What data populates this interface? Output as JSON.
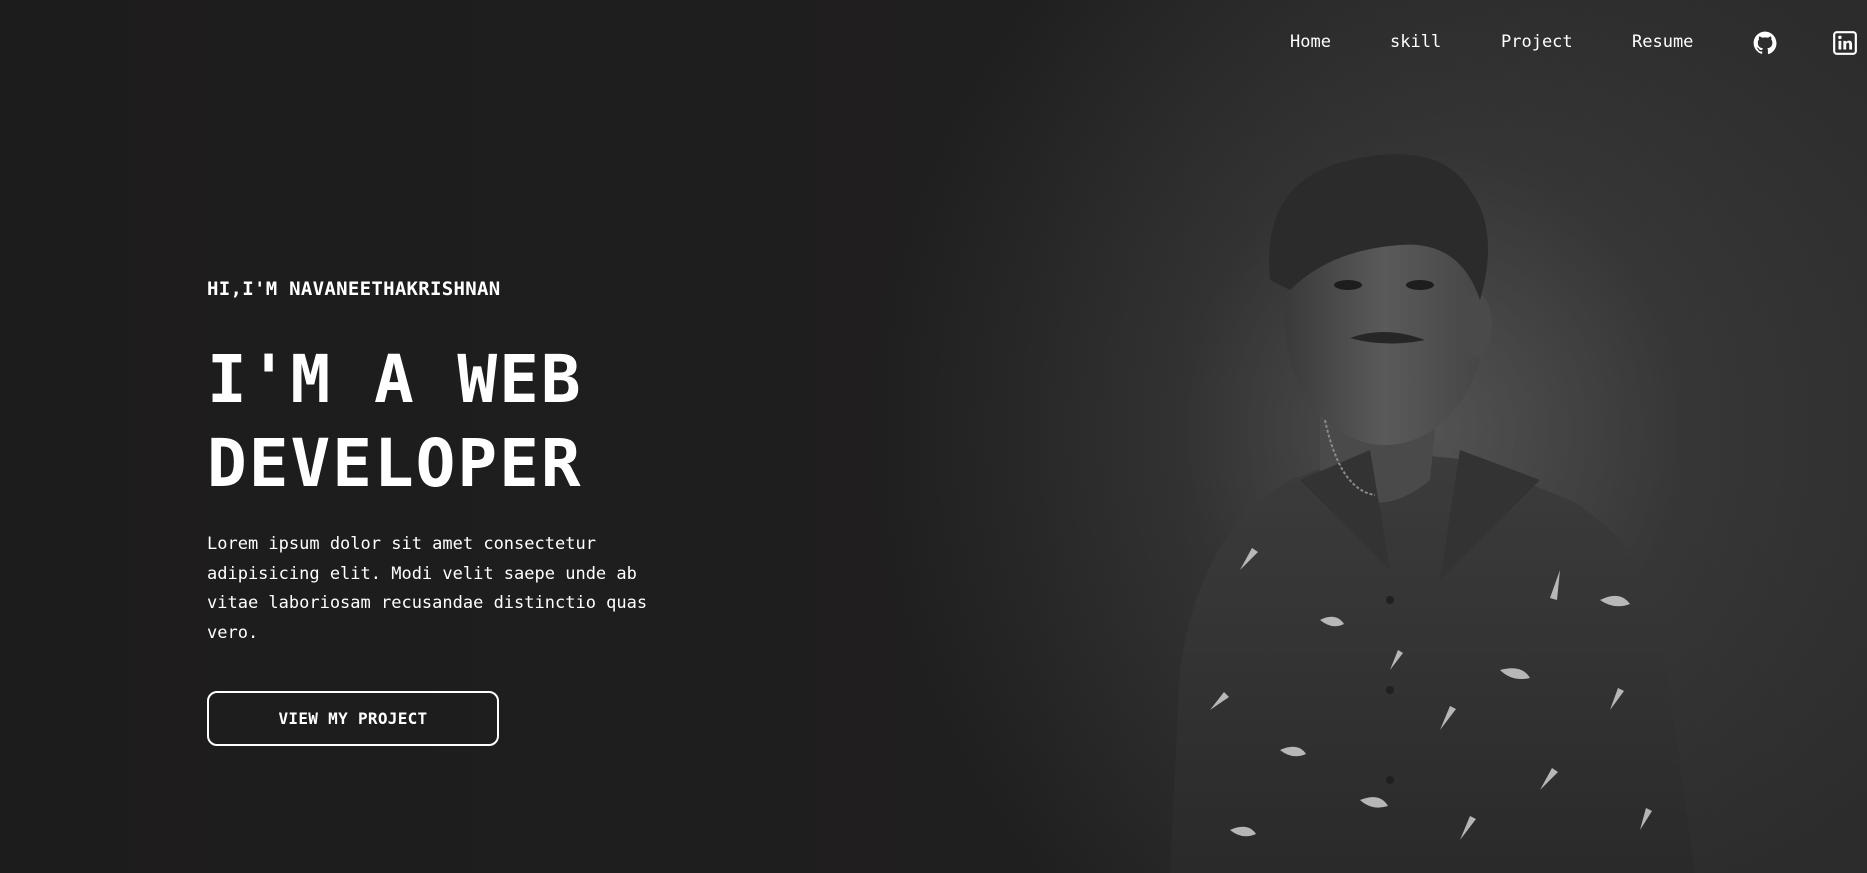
{
  "nav": {
    "home": "Home",
    "skill": "skill",
    "project": "Project",
    "resume": "Resume",
    "github_icon": "github-icon",
    "linkedin_icon": "linkedin-icon"
  },
  "hero": {
    "greeting": "HI,I'M NAVANEETHAKRISHNAN",
    "headline_line1": "I'M A WEB",
    "headline_line2": "DEVELOPER",
    "intro": "Lorem ipsum dolor sit amet consectetur adipisicing elit. Modi velit saepe unde ab vitae laboriosam recusandae distinctio quas vero.",
    "cta_label": "VIEW MY PROJECT"
  },
  "colors": {
    "background": "#1f1e1e",
    "text": "#ffffff",
    "accent": "#ffffff"
  }
}
